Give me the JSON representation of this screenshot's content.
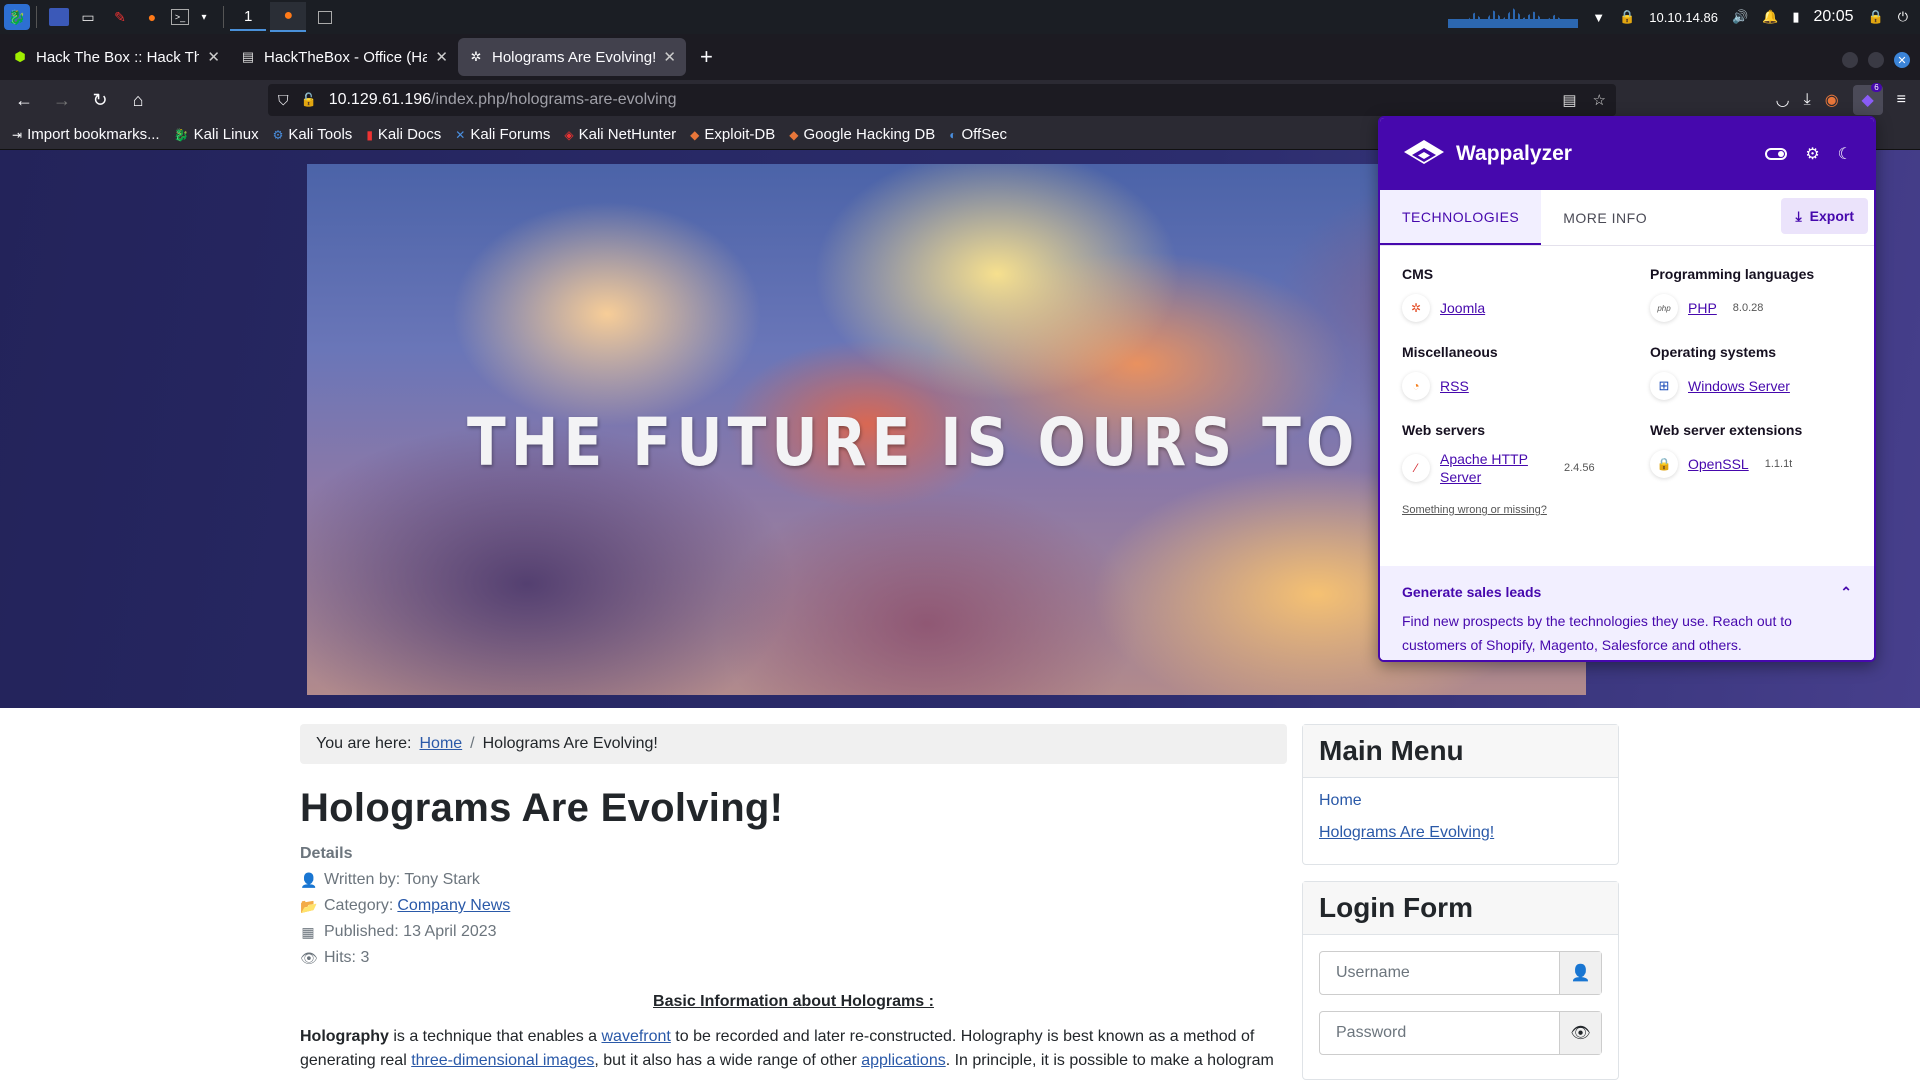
{
  "taskbar": {
    "workspace": "1",
    "ip": "10.10.14.86",
    "time": "20:05"
  },
  "tabs": [
    {
      "title": "Hack The Box :: Hack The Box",
      "active": false
    },
    {
      "title": "HackTheBox - Office (Hard)",
      "active": false
    },
    {
      "title": "Holograms Are Evolving!",
      "active": true
    }
  ],
  "urlbar": {
    "host": "10.129.61.196",
    "path": "/index.php/holograms-are-evolving"
  },
  "bookmarks": [
    "Import bookmarks...",
    "Kali Linux",
    "Kali Tools",
    "Kali Docs",
    "Kali Forums",
    "Kali NetHunter",
    "Exploit-DB",
    "Google Hacking DB",
    "OffSec"
  ],
  "banner": {
    "text": "THE FUTURE IS OURS TO CREATE"
  },
  "breadcrumb": {
    "prefix": "You are here:",
    "home": "Home",
    "separator": "/",
    "current": "Holograms Are Evolving!"
  },
  "article": {
    "title": "Holograms Are Evolving!",
    "details_label": "Details",
    "written_by": "Written by: Tony Stark",
    "category_prefix": "Category:",
    "category": "Company News",
    "published": "Published: 13 April 2023",
    "hits": "Hits: 3",
    "section_heading": "Basic Information about Holograms :",
    "para_bold": "Holography",
    "para_1": " is a technique that enables a ",
    "link_wavefront": "wavefront",
    "para_2": " to be recorded and later re-constructed. Holography is best known as a method of generating real ",
    "link_3d": "three-dimensional images",
    "para_3": ", but it also has a wide range of other ",
    "link_applications": "applications",
    "para_4": ". In principle, it is possible to make a hologram"
  },
  "sidebar": {
    "main_menu_title": "Main Menu",
    "menu_items": [
      "Home",
      "Holograms Are Evolving!"
    ],
    "login_title": "Login Form",
    "username_placeholder": "Username",
    "password_placeholder": "Password"
  },
  "wappalyzer": {
    "brand": "Wappalyzer",
    "badge": "6",
    "tabs": [
      "TECHNOLOGIES",
      "MORE INFO"
    ],
    "export_label": "Export",
    "categories": [
      {
        "name": "CMS",
        "tech": "Joomla",
        "version": ""
      },
      {
        "name": "Programming languages",
        "tech": "PHP",
        "version": "8.0.28"
      },
      {
        "name": "Miscellaneous",
        "tech": "RSS",
        "version": ""
      },
      {
        "name": "Operating systems",
        "tech": "Windows Server",
        "version": ""
      },
      {
        "name": "Web servers",
        "tech": "Apache HTTP Server",
        "version": "2.4.56"
      },
      {
        "name": "Web server extensions",
        "tech": "OpenSSL",
        "version": "1.1.1t"
      }
    ],
    "missing_link": "Something wrong or missing?",
    "leads_title": "Generate sales leads",
    "leads_text": "Find new prospects by the technologies they use. Reach out to customers of Shopify, Magento, Salesforce and others."
  },
  "colors": {
    "wappalyzer_purple": "#4608ad",
    "link_blue": "#2a59a8",
    "browser_chrome": "#2b2a33"
  }
}
